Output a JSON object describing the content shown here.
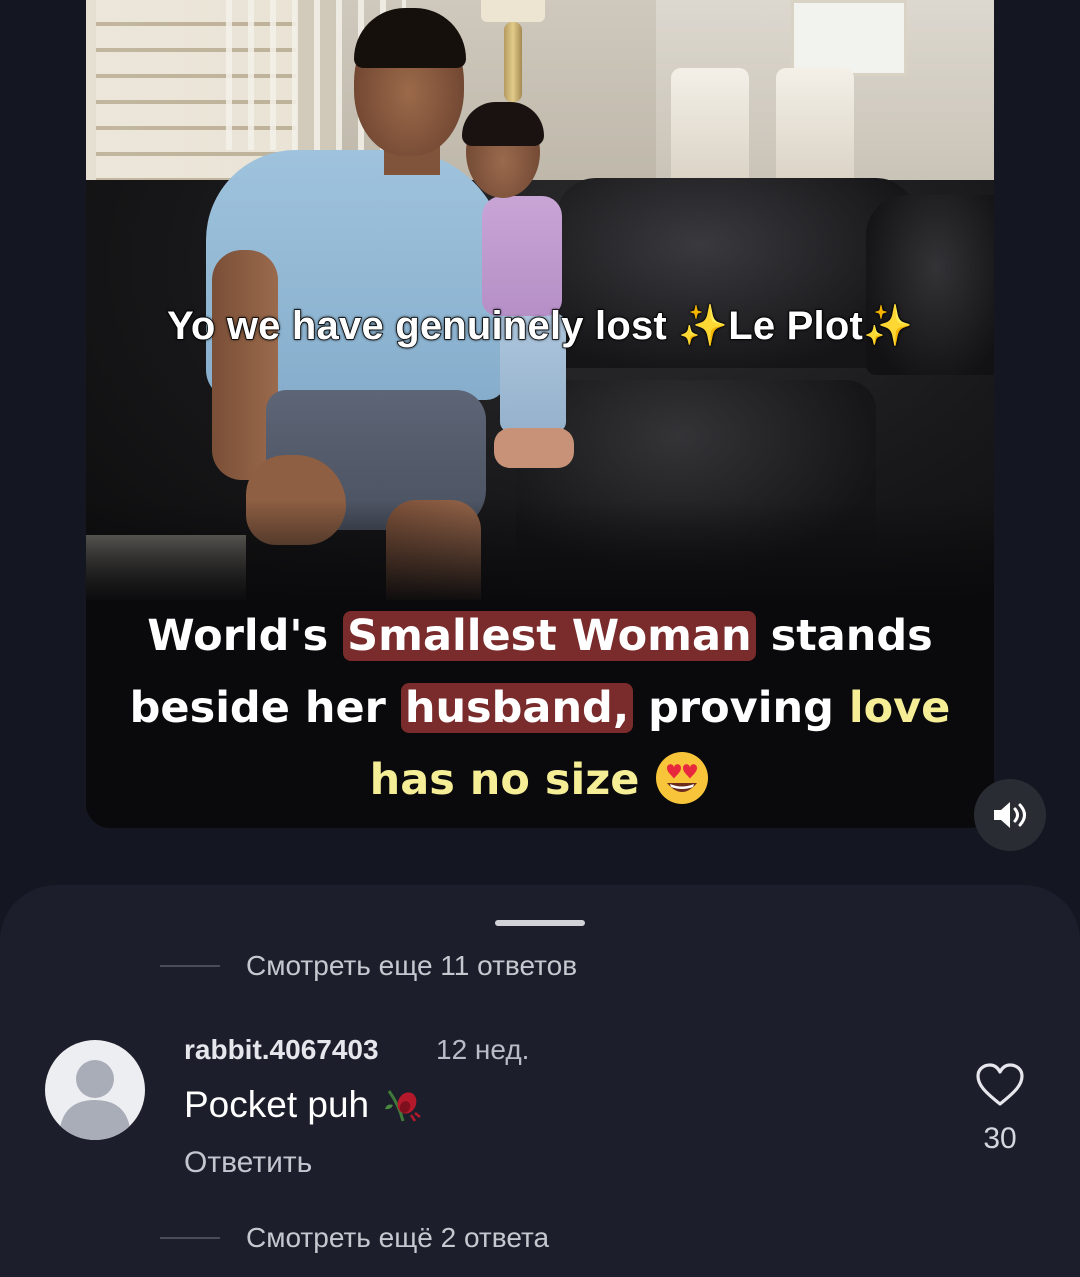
{
  "video": {
    "caption": "Yo we have genuinely lost ✨Le Plot✨",
    "headline": {
      "part1": "World's",
      "highlight1": "Smallest Woman",
      "part2": "stands",
      "part3": "beside her",
      "highlight2": "husband,",
      "part4": "proving",
      "yellow1": "love",
      "yellow2": "has no size"
    },
    "emoji_icon": "heart-eyes-emoji-icon",
    "sound_icon": "speaker-icon"
  },
  "comments": {
    "more_replies_top": "Смотреть еще 11 ответов",
    "comment": {
      "username": "rabbit.4067403",
      "time": "12 нед.",
      "text": "Pocket puh",
      "emoji_icon": "wilted-rose-icon",
      "reply_label": "Ответить",
      "likes": "30",
      "like_icon": "heart-outline-icon"
    },
    "more_replies_bottom": "Смотреть ещё 2 ответа"
  },
  "colors": {
    "background": "#141722",
    "sheet": "#1c1f2b",
    "highlight": "#7a2b2b",
    "yellow_text": "#f6ee96"
  }
}
